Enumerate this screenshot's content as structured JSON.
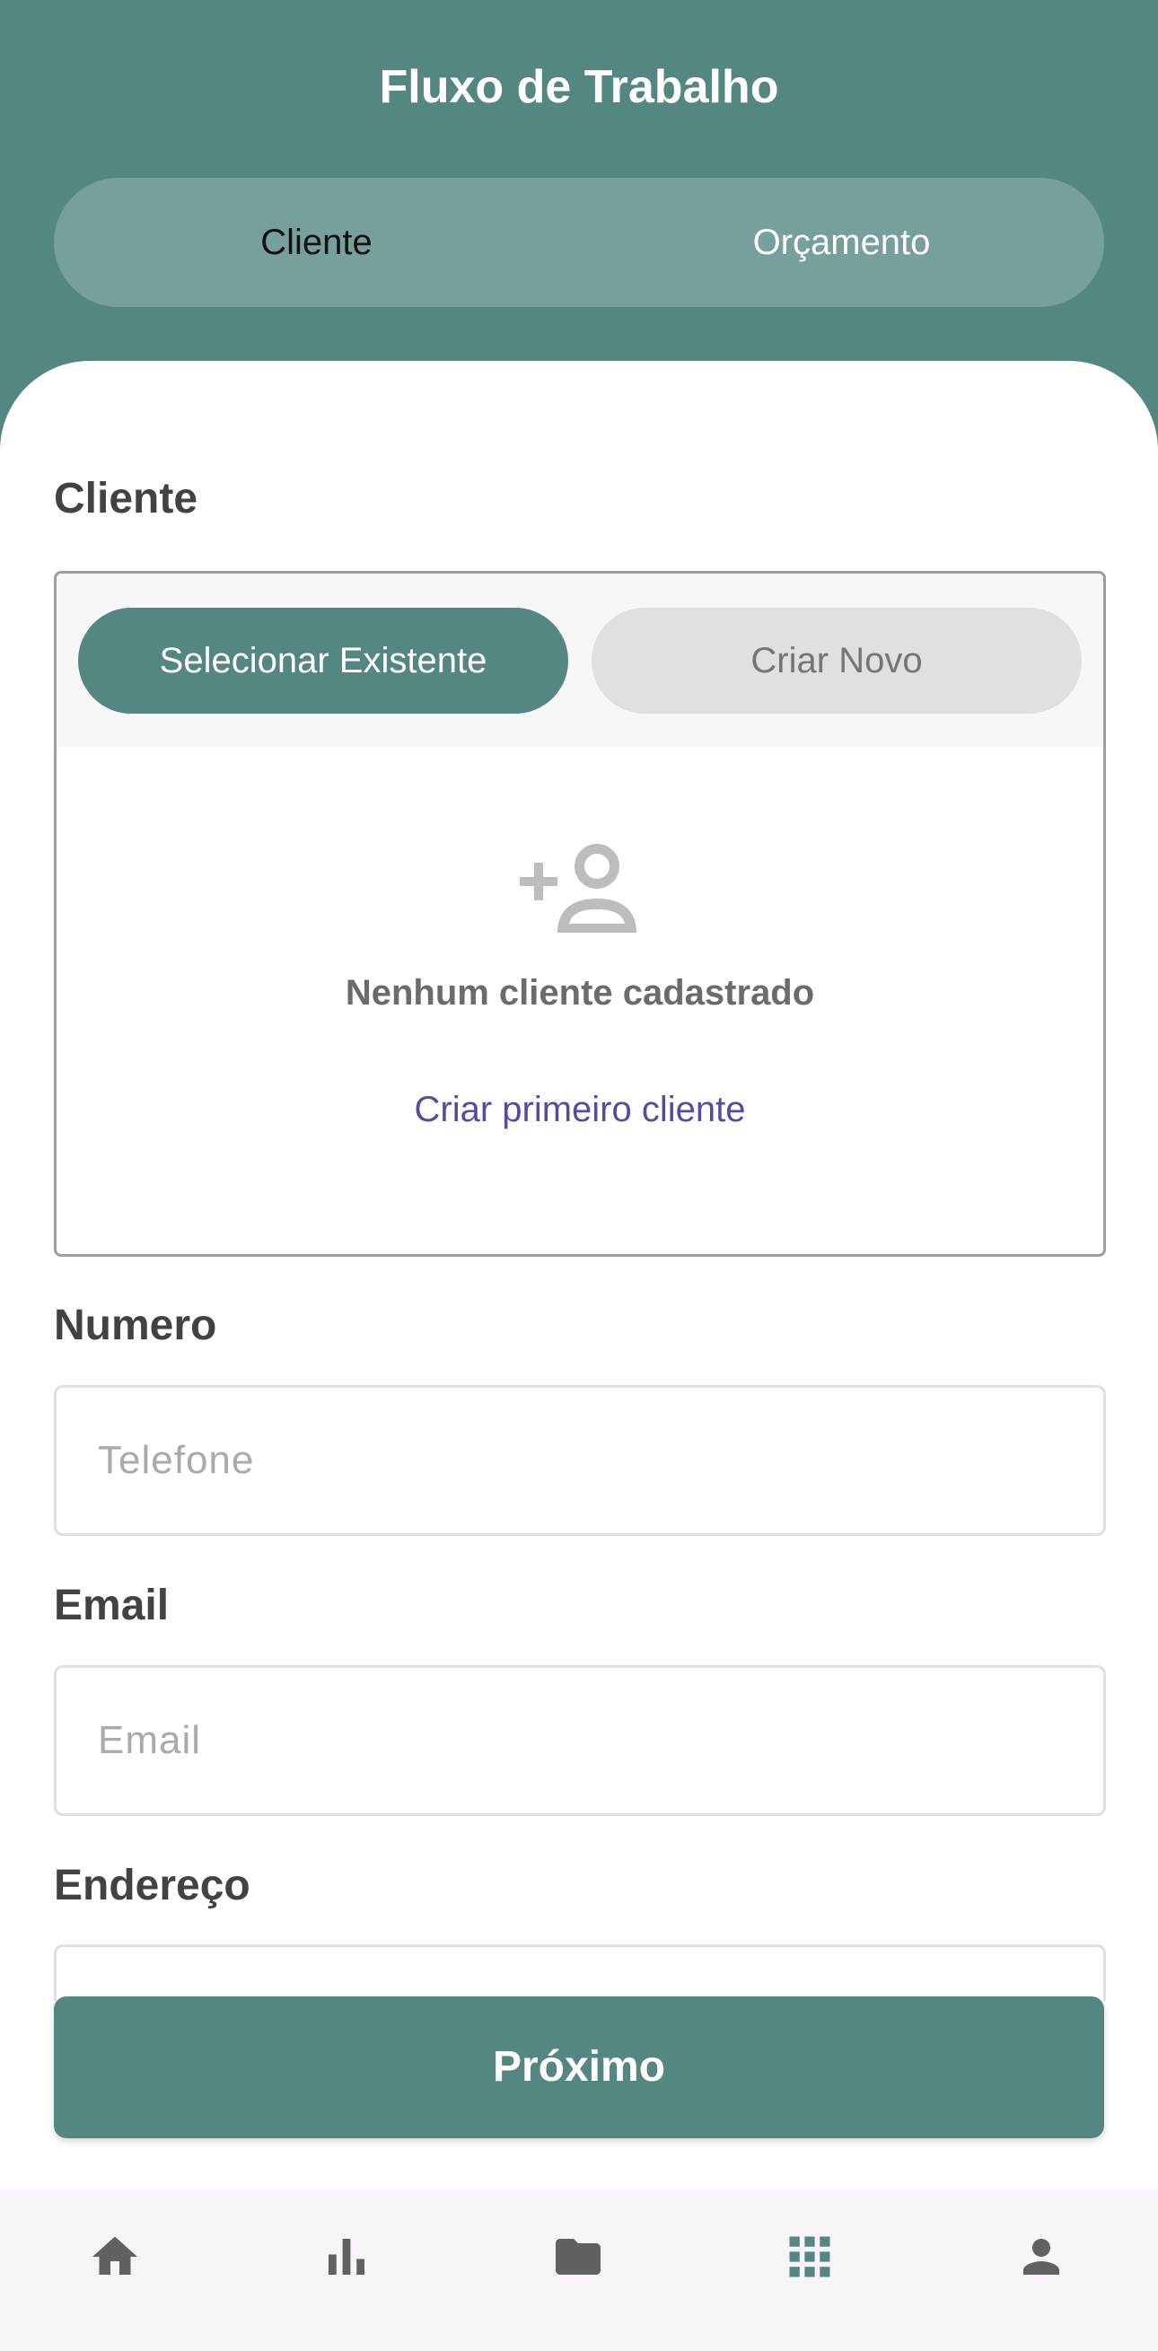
{
  "header": {
    "title": "Fluxo de Trabalho",
    "steps": [
      {
        "label": "Cliente",
        "active": true
      },
      {
        "label": "Orçamento",
        "active": false
      }
    ]
  },
  "client_section": {
    "label": "Cliente",
    "toggle": {
      "select_existing": "Selecionar Existente",
      "create_new": "Criar Novo",
      "selected": "select_existing"
    },
    "empty_state": {
      "icon": "person-add-icon",
      "message": "Nenhum cliente cadastrado",
      "action": "Criar primeiro cliente"
    }
  },
  "phone_field": {
    "label": "Numero",
    "placeholder": "Telefone",
    "value": ""
  },
  "email_field": {
    "label": "Email",
    "placeholder": "Email",
    "value": ""
  },
  "address_field": {
    "label": "Endereço"
  },
  "next_button": {
    "label": "Próximo"
  },
  "bottom_nav": {
    "items": [
      {
        "icon": "home-icon"
      },
      {
        "icon": "bar-chart-icon"
      },
      {
        "icon": "folder-icon"
      },
      {
        "icon": "grid-icon",
        "active": true
      },
      {
        "icon": "person-icon"
      }
    ]
  },
  "colors": {
    "primary": "#548781",
    "tab_track": "#76a09b",
    "link": "#5a4a9c",
    "nav_background": "#f8f4f9"
  }
}
